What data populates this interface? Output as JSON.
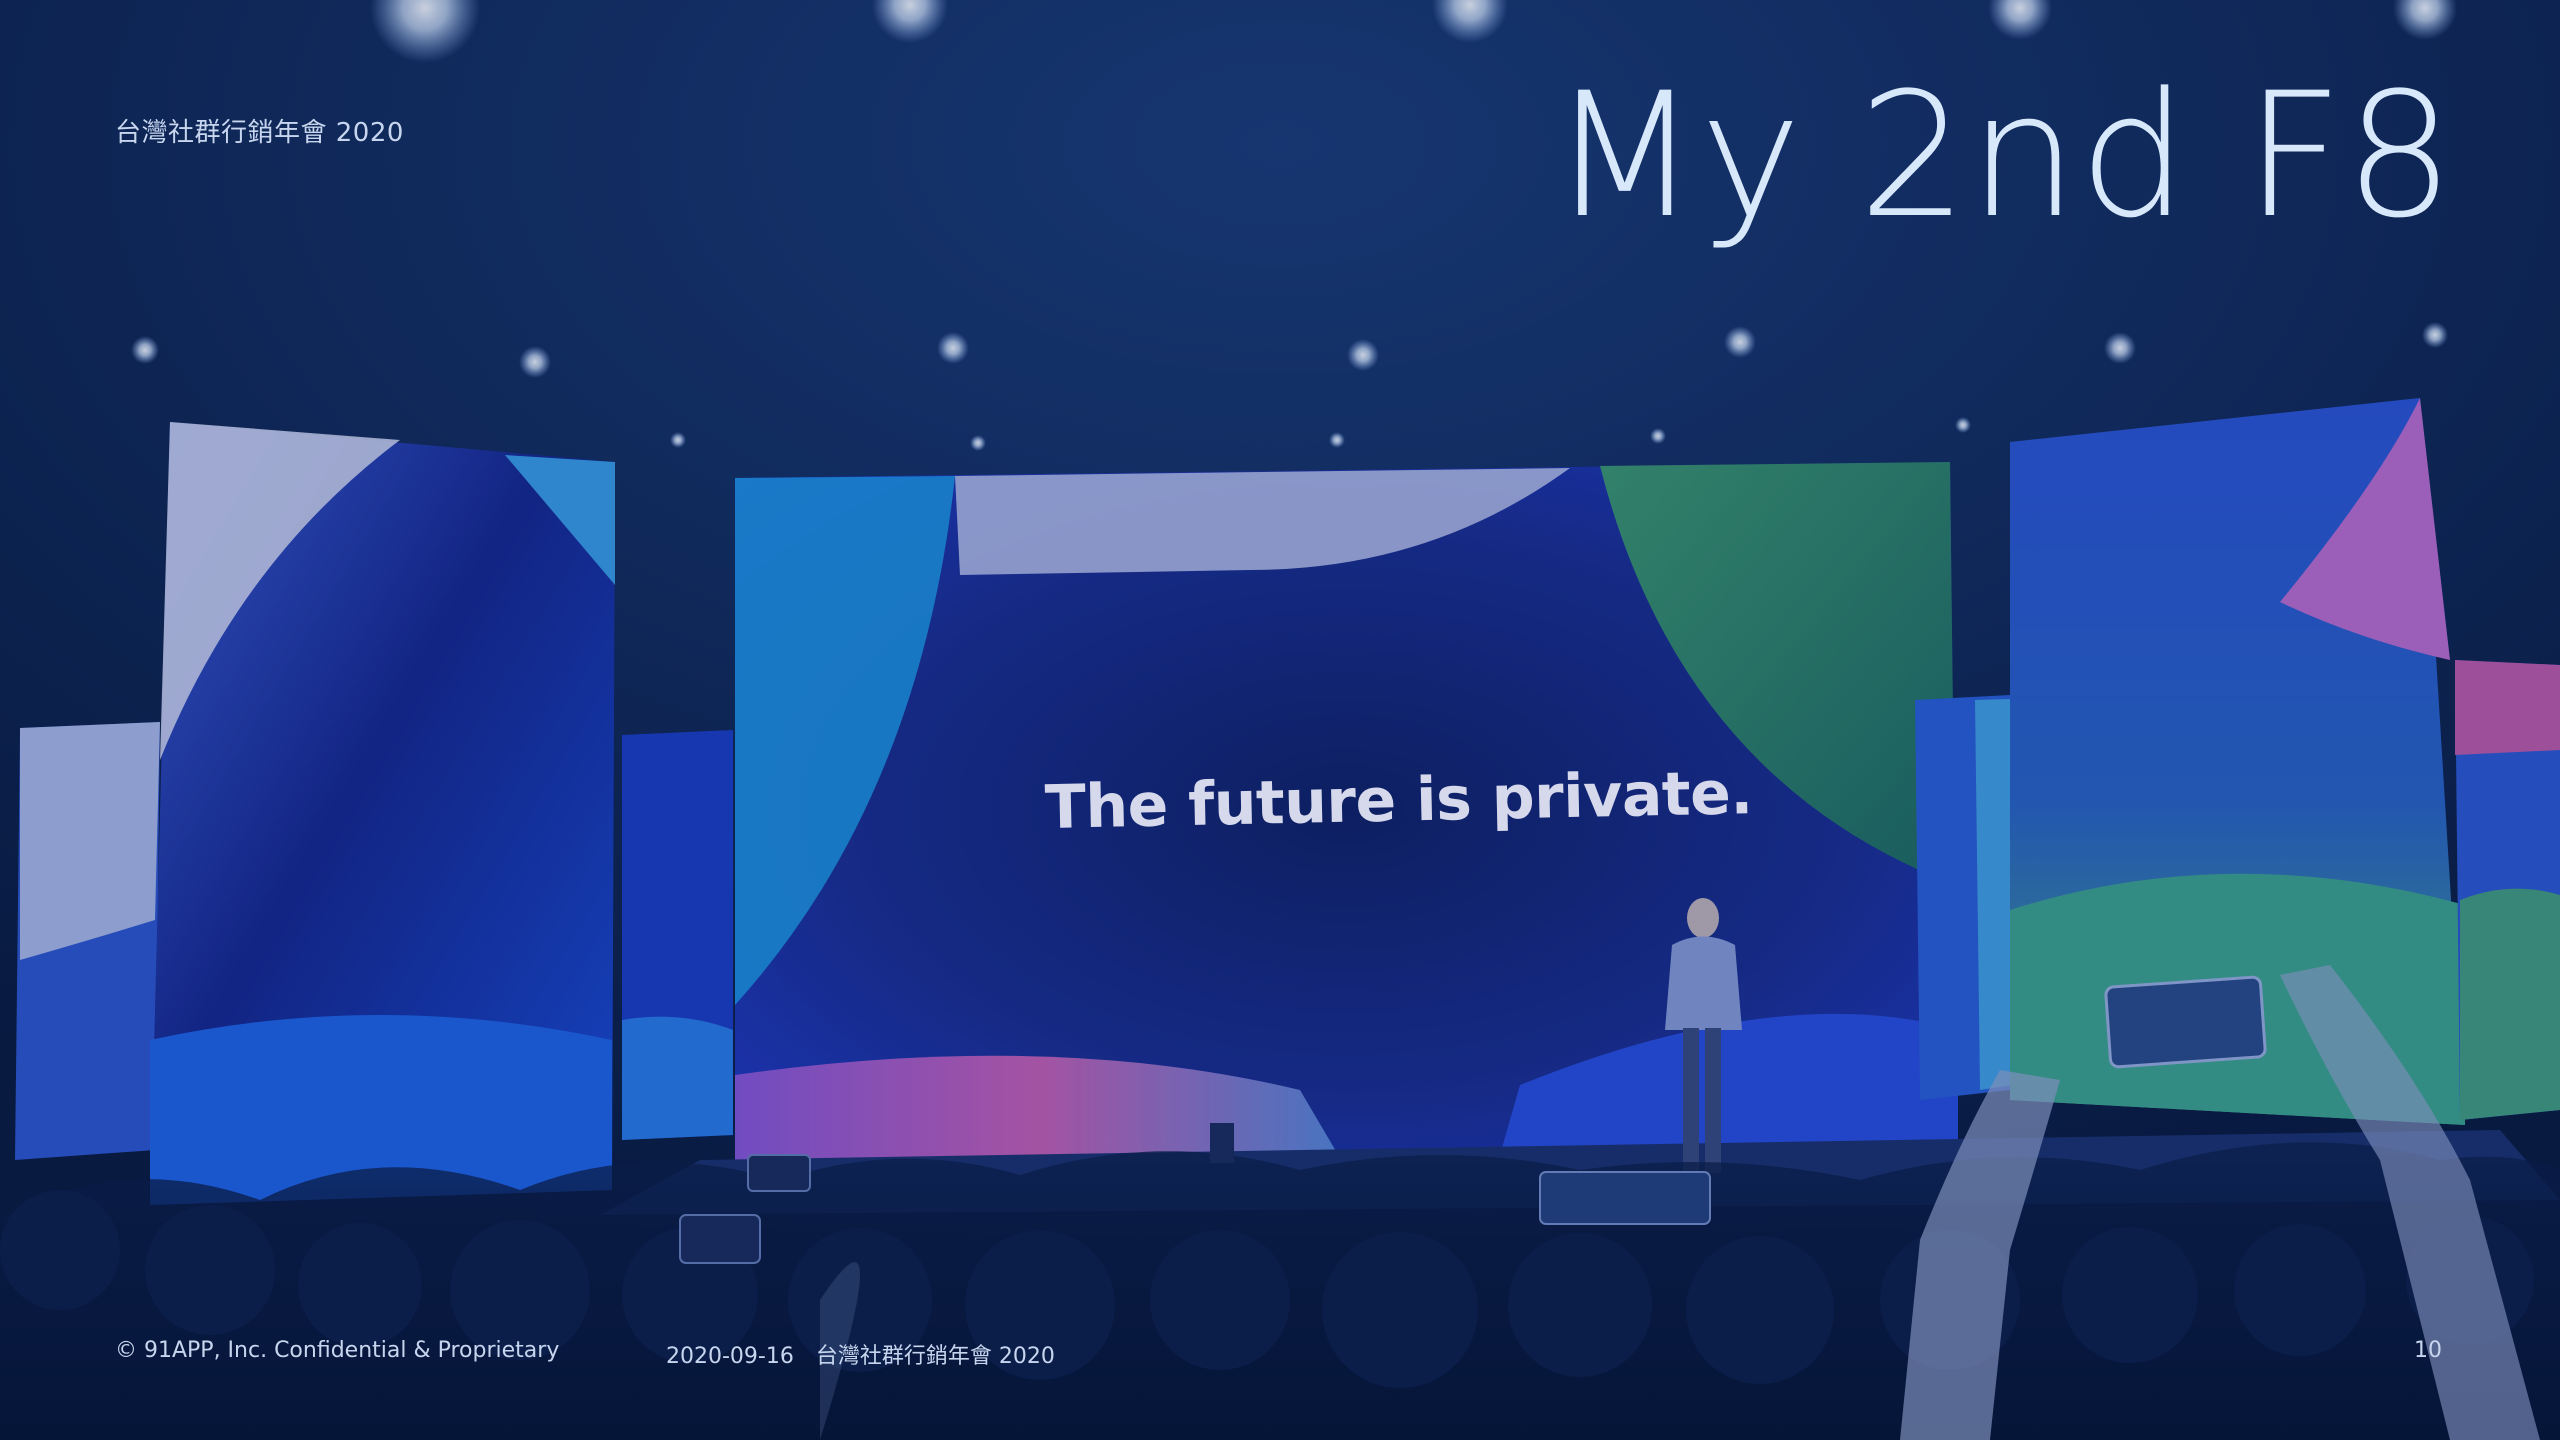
{
  "header": {
    "event_label": "台灣社群行銷年會 2020",
    "title": "My 2nd F8"
  },
  "photo": {
    "screen_text": "The future is private."
  },
  "footer": {
    "copyright": "© 91APP, Inc. Confidential & Proprietary",
    "date": "2020-09-16",
    "event": "台灣社群行銷年會 2020",
    "page_number": "10"
  },
  "colors": {
    "overlay": "#0a286e",
    "title_text": "#d8e8fb",
    "footer_text": "#c7d6ee"
  }
}
